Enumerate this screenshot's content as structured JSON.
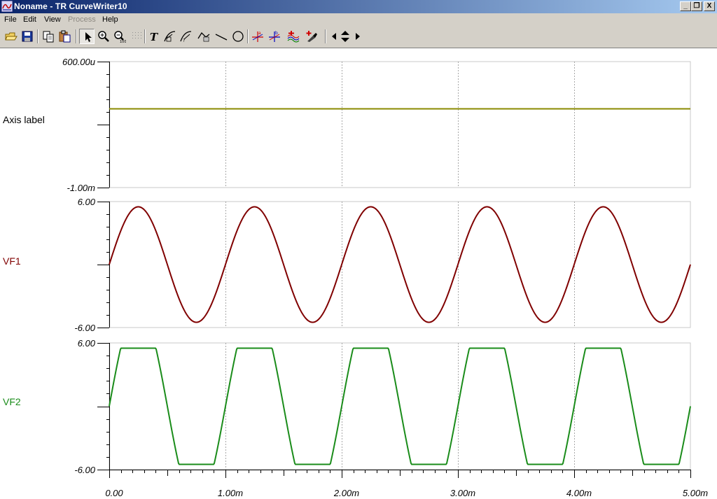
{
  "window": {
    "title": "Noname - TR CurveWriter10",
    "minimize_label": "_",
    "restore_label": "❐",
    "close_label": "X"
  },
  "menu": [
    {
      "label": "File",
      "enabled": true
    },
    {
      "label": "Edit",
      "enabled": true
    },
    {
      "label": "View",
      "enabled": true
    },
    {
      "label": "Process",
      "enabled": false
    },
    {
      "label": "Help",
      "enabled": true
    }
  ],
  "toolbar": {
    "buttons": [
      "open-icon",
      "save-icon",
      "copy-icon",
      "paste-icon",
      "pointer-icon",
      "zoom-in-icon",
      "zoom-out-icon",
      "grid-icon",
      "text-icon",
      "curve-label-icon",
      "curve-label-2-icon",
      "curve-label-3-icon",
      "line-icon",
      "circle-icon",
      "cursor-a-icon",
      "cursor-b-icon",
      "add-curve-icon",
      "marker-icon",
      "arrow-left-icon",
      "arrow-updown-icon",
      "arrow-right-icon"
    ],
    "zoom_out_caption": "100"
  },
  "colors": {
    "panel1_trace": "#8a8a00",
    "panel2_trace": "#800000",
    "panel3_trace": "#1a8c1a",
    "grid": "#a8a8a8",
    "axis": "#000000"
  },
  "chart_data": [
    {
      "type": "line",
      "title": "",
      "ylabel": "Axis label",
      "ylabel_color": "#000000",
      "ylim": [
        -0.001,
        0.0006
      ],
      "yticks_labels": [
        "600.00u",
        "-1.00m"
      ],
      "xlim": [
        0,
        0.005
      ],
      "grid": true,
      "series": [
        {
          "shape": "constant",
          "value": 0.0
        }
      ]
    },
    {
      "type": "line",
      "title": "",
      "ylabel": "VF1",
      "ylabel_color": "#800000",
      "ylim": [
        -6,
        6
      ],
      "yticks_labels": [
        "6.00",
        "-6.00"
      ],
      "xlim": [
        0,
        0.005
      ],
      "grid": true,
      "series": [
        {
          "shape": "sine",
          "amplitude": 5.5,
          "frequency_hz": 1000,
          "offset": 0,
          "phase_deg": 0
        }
      ]
    },
    {
      "type": "line",
      "title": "",
      "ylabel": "VF2",
      "ylabel_color": "#1a8c1a",
      "ylim": [
        -6,
        6
      ],
      "yticks_labels": [
        "6.00",
        "-6.00"
      ],
      "xlim": [
        0,
        0.005
      ],
      "grid": true,
      "series": [
        {
          "shape": "clipped_sine",
          "amplitude": 9.5,
          "clip_level": 5.5,
          "frequency_hz": 1000,
          "offset": 0,
          "phase_deg": 0
        }
      ]
    }
  ],
  "x_axis": {
    "tick_labels": [
      "0.00",
      "1.00m",
      "2.00m",
      "3.00m",
      "4.00m",
      "5.00m"
    ],
    "tick_values": [
      0,
      0.001,
      0.002,
      0.003,
      0.004,
      0.005
    ]
  }
}
